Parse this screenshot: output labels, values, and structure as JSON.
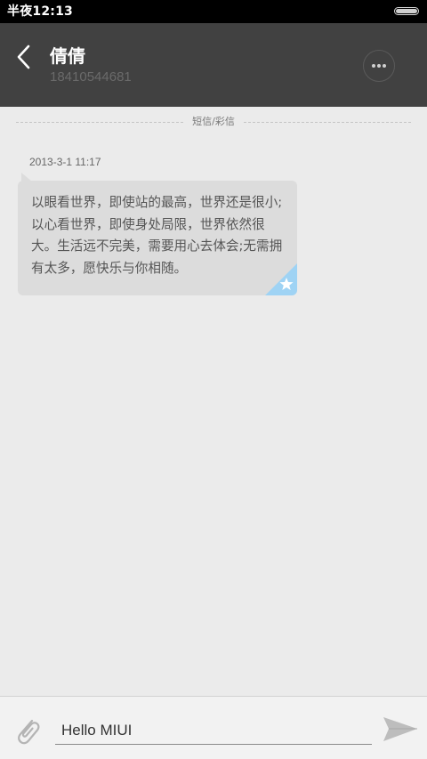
{
  "status_bar": {
    "time": "半夜12:13"
  },
  "header": {
    "contact_name": "倩倩",
    "contact_number": "18410544681",
    "back_icon": "chevron-left-icon",
    "more_icon": "more-dots-icon"
  },
  "conversation": {
    "divider_label": "短信/彩信",
    "messages": [
      {
        "timestamp": "2013-3-1 11:17",
        "text": "以眼看世界，即使站的最高，世界还是很小;以心看世界，即使身处局限，世界依然很大。生活远不完美，需要用心去体会;无需拥有太多，愿快乐与你相随。",
        "starred": true
      }
    ]
  },
  "composer": {
    "input_value": "Hello MIUI",
    "attach_icon": "paperclip-icon",
    "send_icon": "send-icon"
  },
  "colors": {
    "status_bar": "#000000",
    "header": "#414141",
    "background": "#ebebeb",
    "bubble": "#dcdcdc",
    "star_accent": "#9fd3f4"
  }
}
